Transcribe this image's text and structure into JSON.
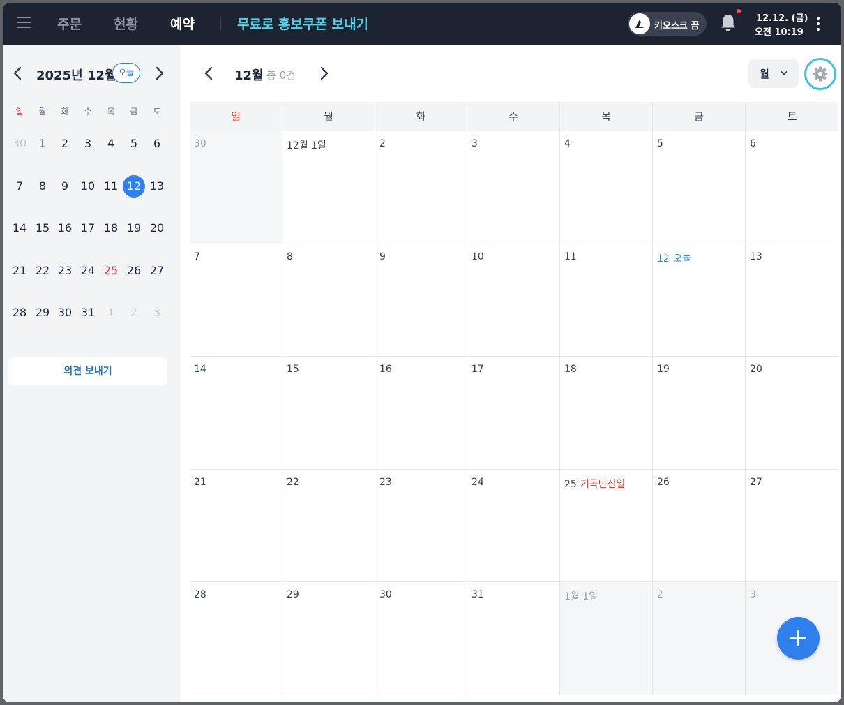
{
  "topbar": {
    "tabs": [
      {
        "label": "주문"
      },
      {
        "label": "현황"
      },
      {
        "label": "예약",
        "active": true
      }
    ],
    "promo_link": "무료로 홍보쿠폰 보내기",
    "kiosk_toggle": "키오스크 끔",
    "datetime": {
      "date": "12.12. (금)",
      "time": "오전 10:19"
    },
    "has_notification": true
  },
  "sidebar": {
    "mini_calendar": {
      "title": "2025년 12월",
      "today_button": "오늘",
      "weekdays": [
        "일",
        "월",
        "화",
        "수",
        "목",
        "금",
        "토"
      ],
      "weeks": [
        [
          "30",
          "1",
          "2",
          "3",
          "4",
          "5",
          "6"
        ],
        [
          "7",
          "8",
          "9",
          "10",
          "11",
          "12",
          "13"
        ],
        [
          "14",
          "15",
          "16",
          "17",
          "18",
          "19",
          "20"
        ],
        [
          "21",
          "22",
          "23",
          "24",
          "25",
          "26",
          "27"
        ],
        [
          "28",
          "29",
          "30",
          "31",
          "1",
          "2",
          "3"
        ]
      ],
      "selected_day": "12",
      "holiday_day": "25"
    },
    "feedback_button": "의견 보내기"
  },
  "main": {
    "title": "12월",
    "count_text": "총 0건",
    "view_select": "월",
    "weekdays": [
      "일",
      "월",
      "화",
      "수",
      "목",
      "금",
      "토"
    ],
    "weeks": [
      [
        "30",
        "12월 1일",
        "2",
        "3",
        "4",
        "5",
        "6"
      ],
      [
        "7",
        "8",
        "9",
        "10",
        "11",
        "12",
        "13"
      ],
      [
        "14",
        "15",
        "16",
        "17",
        "18",
        "19",
        "20"
      ],
      [
        "21",
        "22",
        "23",
        "24",
        "25",
        "26",
        "27"
      ],
      [
        "28",
        "29",
        "30",
        "31",
        "1월 1일",
        "2",
        "3"
      ]
    ],
    "today_label": "오늘",
    "holiday_label": "기독탄신일"
  },
  "colors": {
    "topbar_bg": "#1c2331",
    "accent_blue": "#2f80ed",
    "promo_cyan": "#4fd3e6",
    "holiday_red": "#e53935",
    "gear_ring": "#44c3de"
  },
  "icons": [
    "menu-icon",
    "kiosk-toggle-icon",
    "bell-icon",
    "more-vertical-icon",
    "chevron-left-icon",
    "chevron-right-icon",
    "chevron-down-icon",
    "gear-icon",
    "plus-icon"
  ]
}
